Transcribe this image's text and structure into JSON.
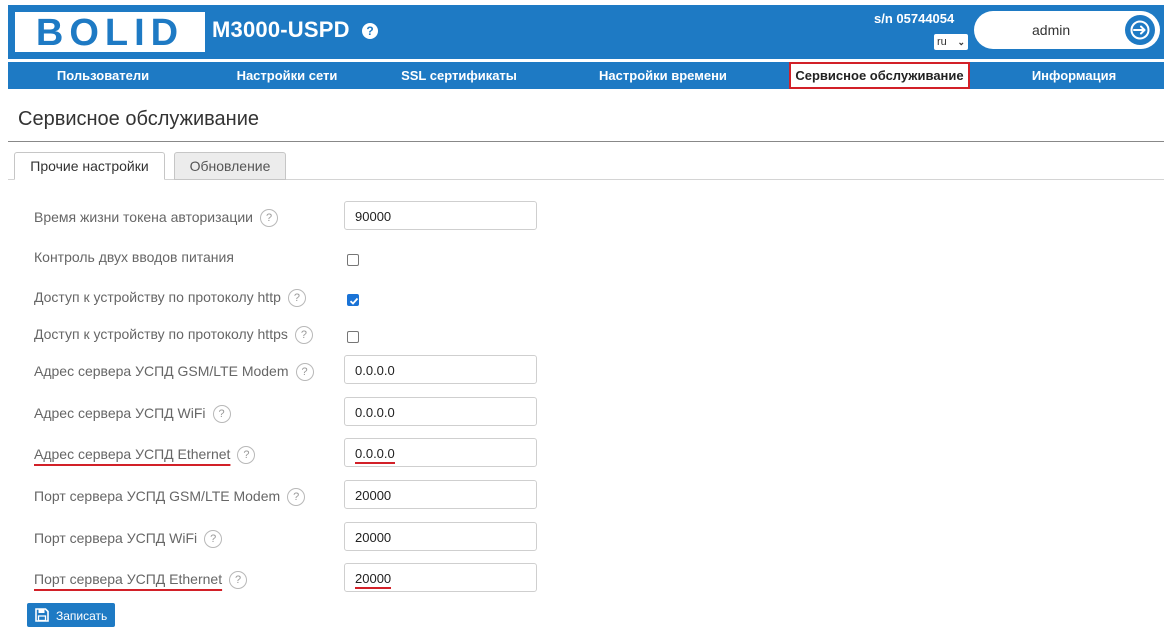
{
  "header": {
    "logo_text": "BOLID",
    "product_title": "M3000-USPD",
    "help_glyph": "?",
    "serial": "s/n 05744054",
    "language": "ru",
    "user": "admin",
    "logout_icon": "logout-icon"
  },
  "nav": {
    "items": [
      {
        "label": "Пользователи"
      },
      {
        "label": "Настройки сети"
      },
      {
        "label": "SSL сертификаты"
      },
      {
        "label": "Настройки времени"
      },
      {
        "label": "Сервисное обслуживание",
        "active": true
      },
      {
        "label": "Информация"
      }
    ]
  },
  "page": {
    "title": "Сервисное обслуживание",
    "tabs": [
      {
        "label": "Прочие настройки",
        "active": true
      },
      {
        "label": "Обновление"
      }
    ]
  },
  "form": {
    "help_glyph": "?",
    "rows": [
      {
        "label": "Время жизни токена авторизации",
        "type": "text",
        "value": "90000",
        "help": true
      },
      {
        "label": "Контроль двух вводов питания",
        "type": "checkbox",
        "checked": false,
        "help": false
      },
      {
        "label": "Доступ к устройству по протоколу http",
        "type": "checkbox",
        "checked": true,
        "help": true
      },
      {
        "label": "Доступ к устройству по протоколу https",
        "type": "checkbox",
        "checked": false,
        "help": true
      },
      {
        "label": "Адрес сервера УСПД GSM/LTE Modem",
        "type": "text",
        "value": "0.0.0.0",
        "help": true
      },
      {
        "label": "Адрес сервера УСПД WiFi",
        "type": "text",
        "value": "0.0.0.0",
        "help": true
      },
      {
        "label": "Адрес сервера УСПД Ethernet",
        "type": "text",
        "value": "0.0.0.0",
        "help": true,
        "highlighted": true
      },
      {
        "label": "Порт сервера УСПД GSM/LTE Modem",
        "type": "text",
        "value": "20000",
        "help": true
      },
      {
        "label": "Порт сервера УСПД WiFi",
        "type": "text",
        "value": "20000",
        "help": true
      },
      {
        "label": "Порт сервера УСПД Ethernet",
        "type": "text",
        "value": "20000",
        "help": true,
        "highlighted": true
      }
    ],
    "save_label": "Записать",
    "save_icon": "floppy-disk-icon"
  },
  "colors": {
    "brand_blue": "#1e7ac4",
    "highlight_red": "#d22028",
    "checkbox_blue": "#1a73d6"
  }
}
